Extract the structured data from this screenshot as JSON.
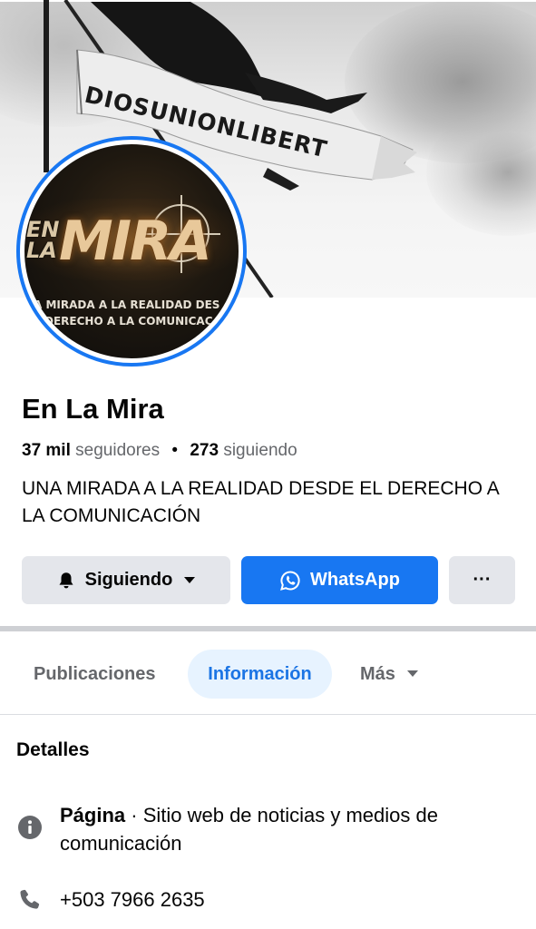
{
  "cover": {
    "banner_text": "DIOSUNIONLIBERT"
  },
  "avatar": {
    "logo_en": "EN",
    "logo_la": "LA",
    "logo_mira": "MIRA",
    "tagline_line1": "A MIRADA A LA REALIDAD DES",
    "tagline_line2": "DERECHO A LA COMUNICAC"
  },
  "profile": {
    "name": "En La Mira",
    "followers_count": "37 mil",
    "followers_label": "seguidores",
    "following_count": "273",
    "following_label": "siguiendo",
    "bio": "UNA MIRADA A LA REALIDAD DESDE EL DERECHO A LA COMUNICACIÓN"
  },
  "actions": {
    "follow_label": "Siguiendo",
    "whatsapp_label": "WhatsApp",
    "more_label": "···"
  },
  "tabs": [
    {
      "label": "Publicaciones",
      "active": false
    },
    {
      "label": "Información",
      "active": true
    },
    {
      "label": "Más",
      "active": false
    }
  ],
  "details": {
    "title": "Detalles",
    "page_label": "Página",
    "page_category": " · Sitio web de noticias y medios de comunicación",
    "phone": "+503 7966 2635"
  },
  "colors": {
    "accent": "#1877f2",
    "active_tab_bg": "#e7f3ff",
    "button_gray": "#e4e6eb"
  },
  "icons": {
    "follow": "bell-icon",
    "whatsapp": "whatsapp-icon",
    "page": "info-icon",
    "phone": "phone-icon"
  }
}
